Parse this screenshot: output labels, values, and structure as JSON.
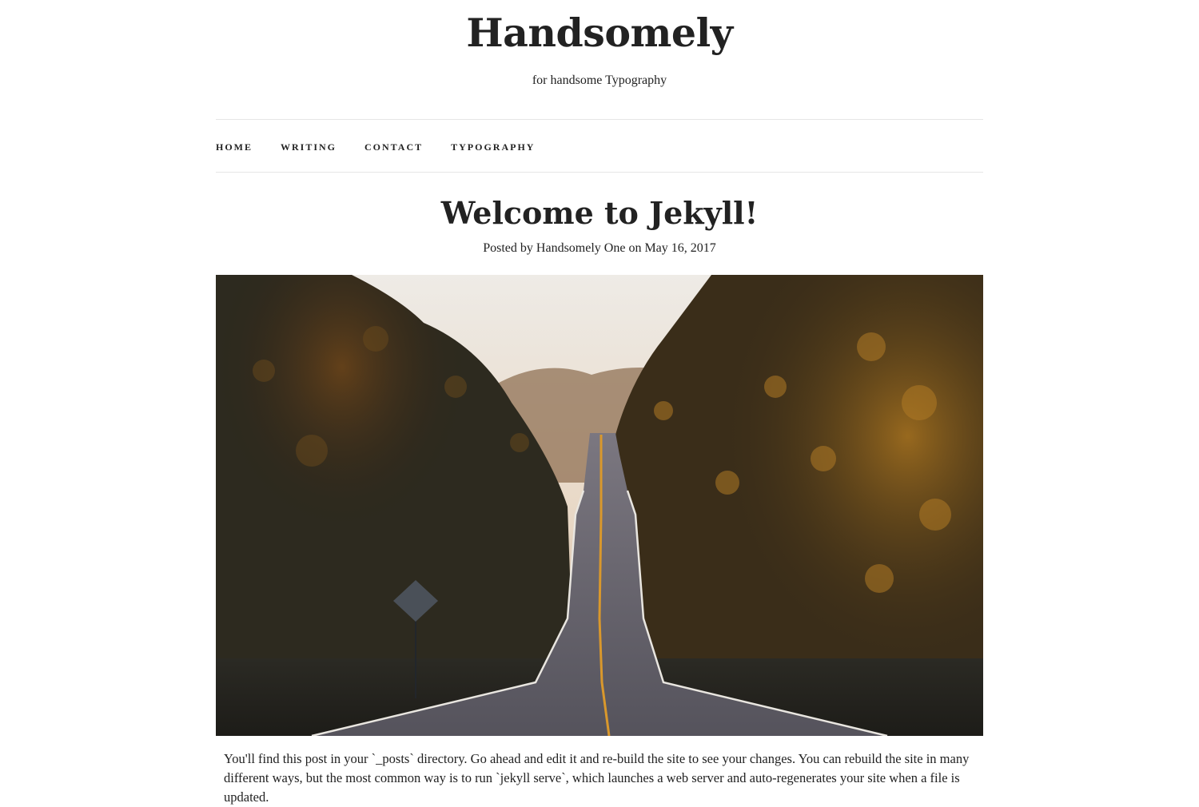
{
  "site": {
    "title": "Handsomely",
    "tagline": "for handsome Typography"
  },
  "nav": {
    "items": [
      {
        "label": "Home"
      },
      {
        "label": "Writing"
      },
      {
        "label": "Contact"
      },
      {
        "label": "Typography"
      }
    ]
  },
  "post": {
    "title": "Welcome to Jekyll!",
    "meta": "Posted by Handsomely One on May 16, 2017",
    "body": "You'll find this post in your `_posts` directory. Go ahead and edit it and re-build the site to see your changes. You can rebuild the site in many different ways, but the most common way is to run `jekyll serve`, which launches a web server and auto-regenerates your site when a file is updated."
  },
  "colors": {
    "text": "#222222",
    "rule": "#e6e6e6",
    "background": "#ffffff"
  }
}
